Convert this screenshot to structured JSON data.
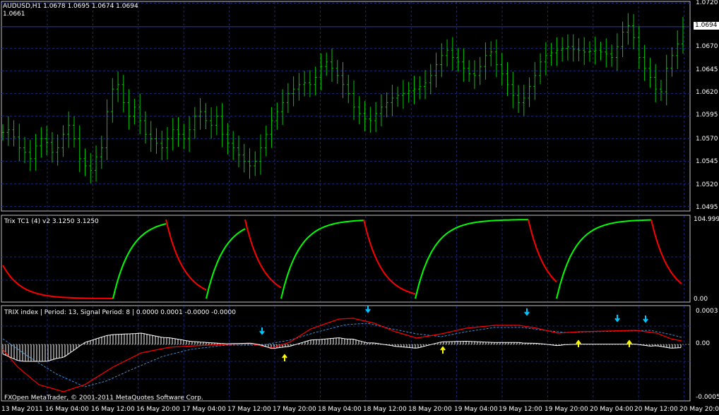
{
  "main": {
    "header": "AUDUSD,H1  1.0678 1.0695 1.0674 1.0694",
    "subheader": "1.0661",
    "price_levels": [
      "1.0720",
      "1.0670",
      "1.0645",
      "1.0620",
      "1.0595",
      "1.0570",
      "1.0545",
      "1.0520",
      "1.0495"
    ],
    "current_price": "1.0694"
  },
  "trix_tc": {
    "header": "Trix TC1 (4) v2 3.1250 3.1250",
    "levels": [
      "104.999",
      "0.00"
    ]
  },
  "trix_index": {
    "header": "TRIX index | Period: 13, Signal Period: 8 |  0.0000 0.0001 -0.0000 -0.0000",
    "levels": [
      "0.0003",
      "0.00",
      "-0.0005"
    ]
  },
  "time_axis": [
    "13 May 2011",
    "16 May 04:00",
    "16 May 12:00",
    "16 May 20:00",
    "17 May 04:00",
    "17 May 12:00",
    "17 May 20:00",
    "18 May 04:00",
    "18 May 12:00",
    "18 May 20:00",
    "19 May 04:00",
    "19 May 12:00",
    "19 May 20:00",
    "20 May 04:00",
    "20 May 12:00",
    "20 May 20:00"
  ],
  "footer": "FXOpen MetaTrader, © 2001-2011 MetaQuotes Software Corp.",
  "colors": {
    "bar": "#00c800",
    "up": "#00ff00",
    "down": "#ff0000",
    "grid": "#1e2a6e",
    "signal": "#3a8fd6",
    "histo": "#ffffff",
    "arrow_down": "#00c8ff",
    "arrow_up": "#ffff00",
    "axis": "#c0c0c0"
  },
  "chart_data": {
    "type": "line",
    "series": [
      {
        "values": [
          1.0577,
          1.058,
          1.0572,
          1.056,
          1.0555,
          1.0548,
          1.0562,
          1.057,
          1.0566,
          1.0555,
          1.056,
          1.0575,
          1.0585,
          1.057,
          1.0548,
          1.054,
          1.0535,
          1.055,
          1.056,
          1.06,
          1.0625,
          1.063,
          1.061,
          1.0595,
          1.0605,
          1.059,
          1.0575,
          1.057,
          1.0565,
          1.056,
          1.057,
          1.058,
          1.0575,
          1.057,
          1.058,
          1.0595,
          1.06,
          1.059,
          1.0585,
          1.0595,
          1.0575,
          1.0565,
          1.056,
          1.0552,
          1.0545,
          1.054,
          1.0545,
          1.056,
          1.0575,
          1.059,
          1.06,
          1.061,
          1.062,
          1.0625,
          1.063,
          1.0632,
          1.063,
          1.0638,
          1.065,
          1.0655,
          1.0648,
          1.064,
          1.063,
          1.062,
          1.0605,
          1.0598,
          1.0592,
          1.059,
          1.0598,
          1.0605,
          1.061,
          1.0615,
          1.0618,
          1.062,
          1.0623,
          1.0625,
          1.0628,
          1.0632,
          1.064,
          1.0652,
          1.0662,
          1.0668,
          1.066,
          1.0655,
          1.0648,
          1.0642,
          1.064,
          1.065,
          1.0662,
          1.0666,
          1.0652,
          1.0642,
          1.063,
          1.0618,
          1.061,
          1.0615,
          1.0628,
          1.064,
          1.0655,
          1.0662,
          1.0665,
          1.0668,
          1.067,
          1.0672,
          1.0669,
          1.0668,
          1.0666,
          1.0667,
          1.0668,
          1.0666,
          1.0664,
          1.066,
          1.0672,
          1.0688,
          1.0695,
          1.0682,
          1.066,
          1.0648,
          1.0638,
          1.0625,
          1.0622,
          1.0648,
          1.0662,
          1.0675,
          1.0694
        ]
      }
    ]
  }
}
